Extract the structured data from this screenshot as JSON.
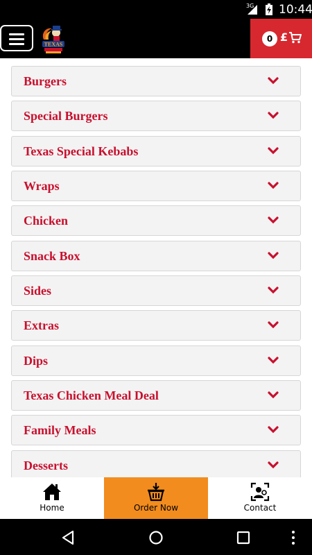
{
  "status_bar": {
    "network": "3G",
    "time": "10:44"
  },
  "header": {
    "menu_icon": "hamburger-icon",
    "logo_text": "TEXAS",
    "cart": {
      "count": "0",
      "currency": "£",
      "icon": "cart-icon"
    }
  },
  "categories": [
    {
      "label": "Burgers"
    },
    {
      "label": "Special Burgers"
    },
    {
      "label": "Texas Special Kebabs"
    },
    {
      "label": "Wraps"
    },
    {
      "label": "Chicken"
    },
    {
      "label": "Snack Box"
    },
    {
      "label": "Sides"
    },
    {
      "label": "Extras"
    },
    {
      "label": "Dips"
    },
    {
      "label": "Texas Chicken Meal Deal"
    },
    {
      "label": "Family Meals"
    },
    {
      "label": "Desserts"
    }
  ],
  "bottom_nav": {
    "items": [
      {
        "label": "Home",
        "icon": "home-icon"
      },
      {
        "label": "Order Now",
        "icon": "basket-icon",
        "active": true
      },
      {
        "label": "Contact",
        "icon": "contact-icon"
      }
    ]
  },
  "colors": {
    "accent_red": "#d7282f",
    "category_text": "#c8102e",
    "active_tab": "#f28c1e"
  }
}
